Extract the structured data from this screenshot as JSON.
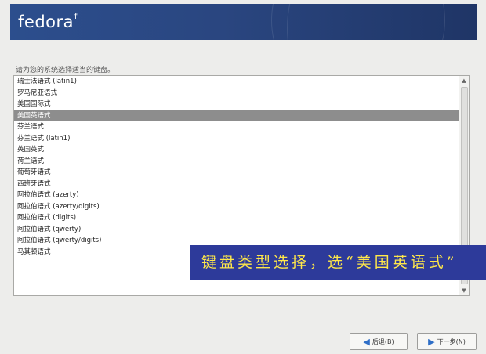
{
  "header": {
    "logo_text": "fedora",
    "logo_mark": "f"
  },
  "prompt_text": "请为您的系统选择适当的键盘。",
  "keyboard_list": {
    "items": [
      "瑞士法语式 (latin1)",
      "罗马尼亚语式",
      "美国国际式",
      "美国英语式",
      "芬兰语式",
      "芬兰语式 (latin1)",
      "英国英式",
      "荷兰语式",
      "葡萄牙语式",
      "西班牙语式",
      "阿拉伯语式 (azerty)",
      "阿拉伯语式 (azerty/digits)",
      "阿拉伯语式 (digits)",
      "阿拉伯语式 (qwerty)",
      "阿拉伯语式 (qwerty/digits)",
      "马其顿语式"
    ],
    "selected_index": 3
  },
  "annotation_text": "键盘类型选择，选“美国英语式”",
  "buttons": {
    "back_label": "后退(B)",
    "next_label": "下一步(N)"
  },
  "colors": {
    "banner": "#2c4e8d",
    "selection": "#8d8d8d",
    "annotation_bg": "#2d3a9a",
    "annotation_text": "#ffe84a"
  }
}
